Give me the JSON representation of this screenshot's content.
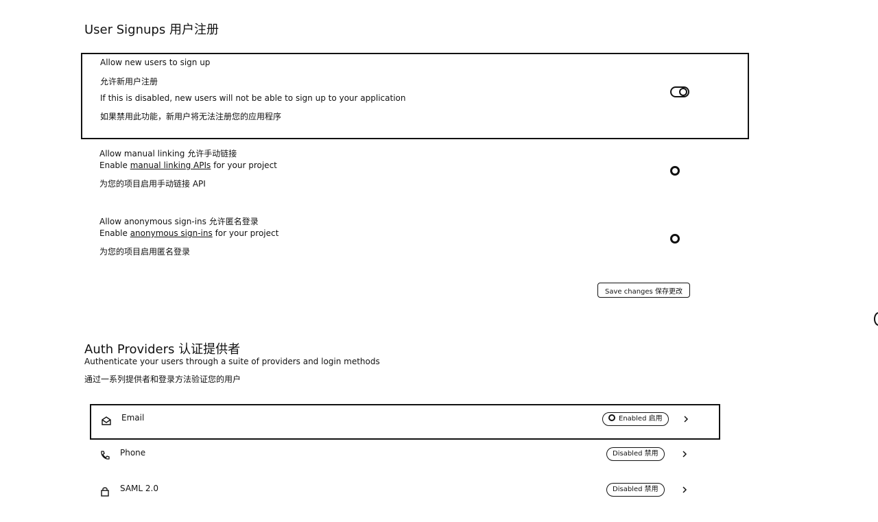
{
  "user_signups": {
    "title": "User Signups  用户注册",
    "allow_new_users": {
      "label": "Allow new users to sign up",
      "label_cn": "允许新用户注册",
      "description": "If this is disabled, new users will not be able to sign up to your application",
      "description_cn": "如果禁用此功能，新用户将无法注册您的应用程序",
      "enabled": true
    },
    "manual_linking": {
      "label": "Allow manual linking  允许手动链接",
      "desc_prefix": "Enable ",
      "desc_link": "manual linking APIs",
      "desc_suffix": " for your project",
      "description_cn": "为您的项目启用手动链接 API",
      "enabled": false
    },
    "anonymous": {
      "label": "Allow anonymous sign-ins  允许匿名登录",
      "desc_prefix": "Enable ",
      "desc_link": "anonymous sign-ins",
      "desc_suffix": " for your project",
      "description_cn": "为您的项目启用匿名登录",
      "enabled": false
    },
    "save_label": "Save changes  保存更改"
  },
  "auth_providers": {
    "title": "Auth Providers  认证提供者",
    "subtitle": "Authenticate your users through a suite of providers and login methods",
    "subtitle_cn": "通过一系列提供者和登录方法验证您的用户",
    "providers": [
      {
        "name": "Email",
        "status": "Enabled  启用",
        "icon": "mail-icon"
      },
      {
        "name": "Phone",
        "status": "Disabled  禁用",
        "icon": "phone-icon"
      },
      {
        "name": "SAML 2.0",
        "status": "Disabled  禁用",
        "icon": "lock-icon"
      }
    ]
  }
}
